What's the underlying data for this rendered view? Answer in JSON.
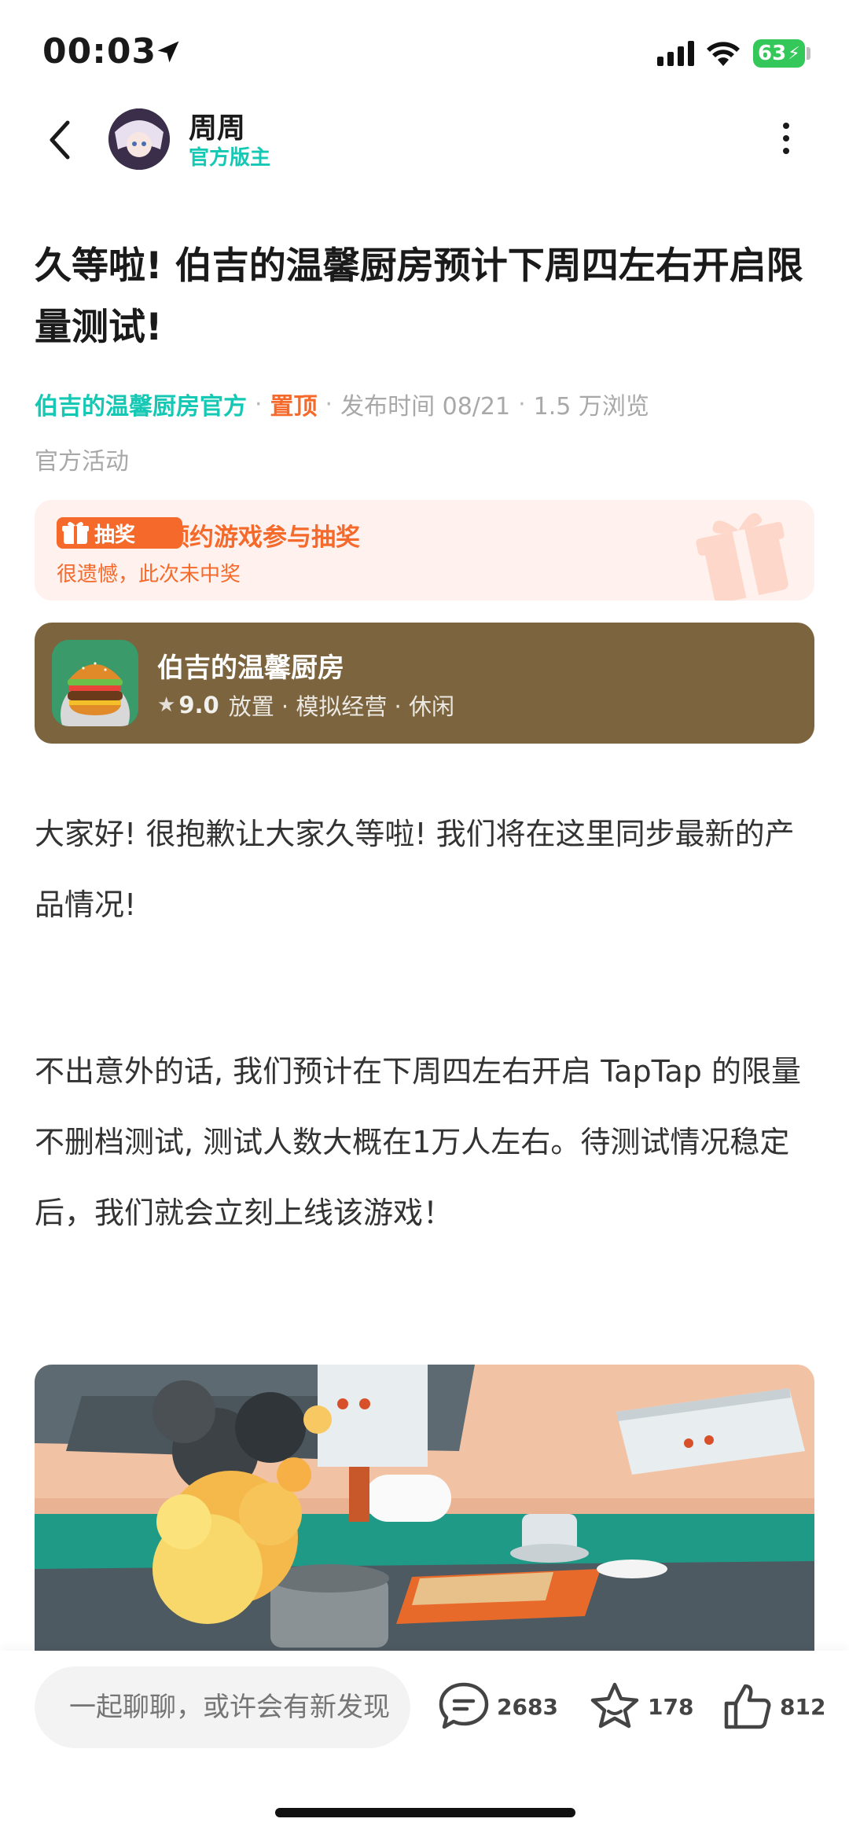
{
  "status_bar": {
    "time": "00:03",
    "battery": "63"
  },
  "header": {
    "author_name": "周周",
    "author_role": "官方版主"
  },
  "post": {
    "title": "久等啦! 伯吉的温馨厨房预计下周四左右开启限量测试!",
    "forum": "伯吉的温馨厨房官方",
    "pinned": "置顶",
    "publish_time": "发布时间 08/21",
    "views": "1.5 万浏览",
    "category": "官方活动",
    "paragraph1": "大家好! 很抱歉让大家久等啦! 我们将在这里同步最新的产品情况!",
    "paragraph2": "不出意外的话, 我们预计在下周四左右开启 TapTap 的限量不删档测试, 测试人数大概在1万人左右。待测试情况稳定后，我们就会立刻上线该游戏！"
  },
  "lottery": {
    "badge": "抽奖",
    "title": "预约游戏参与抽奖",
    "status": "很遗憾，此次未中奖"
  },
  "game": {
    "name": "伯吉的温馨厨房",
    "rating": "9.0",
    "tags": "放置 · 模拟经营 · 休闲"
  },
  "bottom_bar": {
    "input_placeholder": "一起聊聊，或许会有新发现",
    "comments": "2683",
    "favorites": "178",
    "likes": "812"
  },
  "colors": {
    "accent_teal": "#14c8b4",
    "accent_orange": "#f56a2b",
    "game_card": "#7b643e"
  }
}
